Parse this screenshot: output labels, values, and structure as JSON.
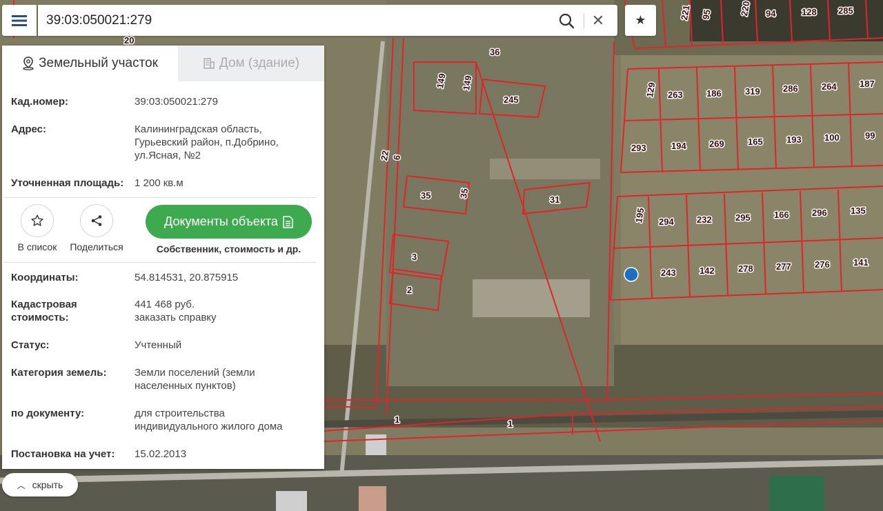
{
  "search": {
    "value": "39:03:050021:279"
  },
  "tabs": [
    {
      "label": "Земельный участок"
    },
    {
      "label": "Дом (здание)"
    }
  ],
  "info": {
    "cadastral_label": "Кад.номер:",
    "cadastral_value": "39:03:050021:279",
    "address_label": "Адрес:",
    "address_value": "Калининградская область, Гурьевский район, п.Добрино, ул.Ясная, №2",
    "area_label": "Уточненная площадь:",
    "area_value": "1 200 кв.м",
    "coords_label": "Координаты:",
    "coords_value": "54.814531, 20.875915",
    "cost_label": "Кадастровая стоимость:",
    "cost_value": "441 468 руб.",
    "cost_link": "заказать справку",
    "status_label": "Статус:",
    "status_value": "Учтенный",
    "category_label": "Категория земель:",
    "category_value": "Земли поселений (земли населенных пунктов)",
    "bydoc_label": "по документу:",
    "bydoc_value": "для строительства индивидуального жилого дома",
    "registered_label": "Постановка на учет:",
    "registered_value": "15.02.2013"
  },
  "actions": {
    "add_to_list": "В список",
    "share": "Поделиться",
    "documents": "Документы объекта",
    "documents_sub": "Собственник, стоимость и др."
  },
  "collapse_label": "скрыть",
  "map_labels": [
    "20",
    "36",
    "149",
    "149",
    "245",
    "22",
    "6",
    "35",
    "35",
    "31",
    "3",
    "2",
    "1",
    "1",
    "221",
    "95",
    "220",
    "94",
    "128",
    "285",
    "129",
    "263",
    "186",
    "319",
    "286",
    "264",
    "187",
    "293",
    "194",
    "269",
    "165",
    "193",
    "100",
    "99",
    "195",
    "294",
    "232",
    "295",
    "166",
    "296",
    "135",
    "243",
    "142",
    "278",
    "277",
    "276",
    "141"
  ],
  "colors": {
    "accent_green": "#3eaa4f",
    "link_blue": "#1d6a8f",
    "parcel_red": "#e0242a",
    "marker_blue": "#1d6fc1"
  }
}
